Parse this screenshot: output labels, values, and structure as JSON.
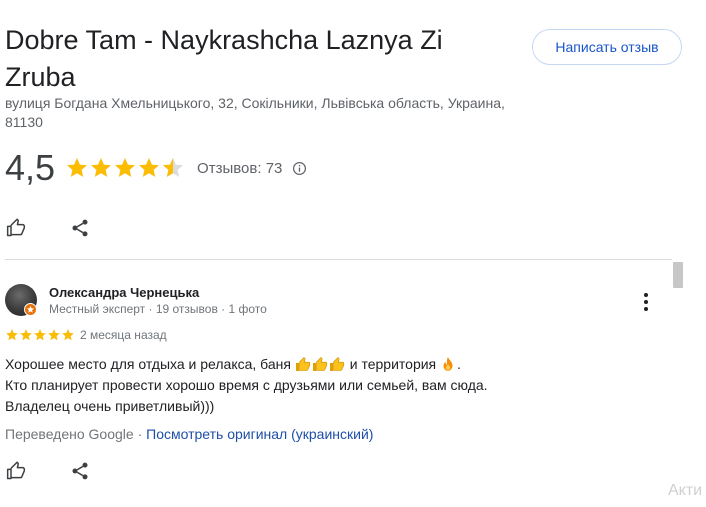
{
  "place": {
    "title": "Dobre Tam - Naykrashcha Laznya Zi Zruba",
    "address": "вулиця Богдана Хмельницького, 32, Сокільники, Львівська область, Украина, 81130",
    "rating": "4,5",
    "rating_value": 4.5,
    "reviews_label": "Отзывов: 73"
  },
  "write_review_label": "Написать отзыв",
  "review": {
    "author": "Олександра Чернецька",
    "meta": "Местный эксперт · 19 отзывов · 1 фото",
    "stars": 5,
    "date": "2 месяца назад",
    "text_line1a": "Хорошее место для отдыха и релакса, баня",
    "text_line1b": "и территория",
    "text_line2": "Кто планирует провести хорошо время с друзьями или семьей, вам сюда.",
    "text_line3": "Владелец очень приветливый)))",
    "translated_label": "Переведено Google",
    "separator": "·",
    "original_link": "Посмотреть оригинал (украинский)"
  },
  "watermark": "Акти",
  "icons": {
    "like": "thumbs-up-icon",
    "share": "share-icon",
    "info": "info-icon",
    "more": "more-vert-icon"
  },
  "colors": {
    "star": "#fbbc04",
    "star_empty": "#dadce0",
    "link": "#1a56c9"
  }
}
